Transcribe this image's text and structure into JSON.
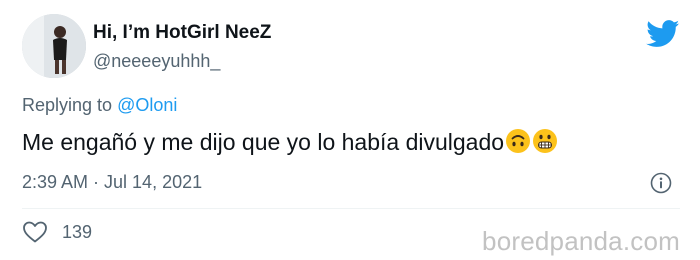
{
  "user": {
    "display_name": "Hi, I’m HotGirl NeeZ",
    "handle": "@neeeeyuhhh_"
  },
  "reply": {
    "prefix": "Replying to",
    "mention": "@Oloni"
  },
  "tweet": {
    "text": "Me engañó y me dijo que yo lo había divulgado",
    "emojis": [
      "upside-down-face-emoji",
      "grimacing-face-emoji"
    ]
  },
  "meta": {
    "timestamp": "2:39 AM · Jul 14, 2021"
  },
  "actions": {
    "like_count": "139"
  },
  "watermark": "boredpanda.com",
  "colors": {
    "accent": "#1d9bf0",
    "text": "#0f1419",
    "secondary": "#536471",
    "emoji": "#fcc21b"
  }
}
